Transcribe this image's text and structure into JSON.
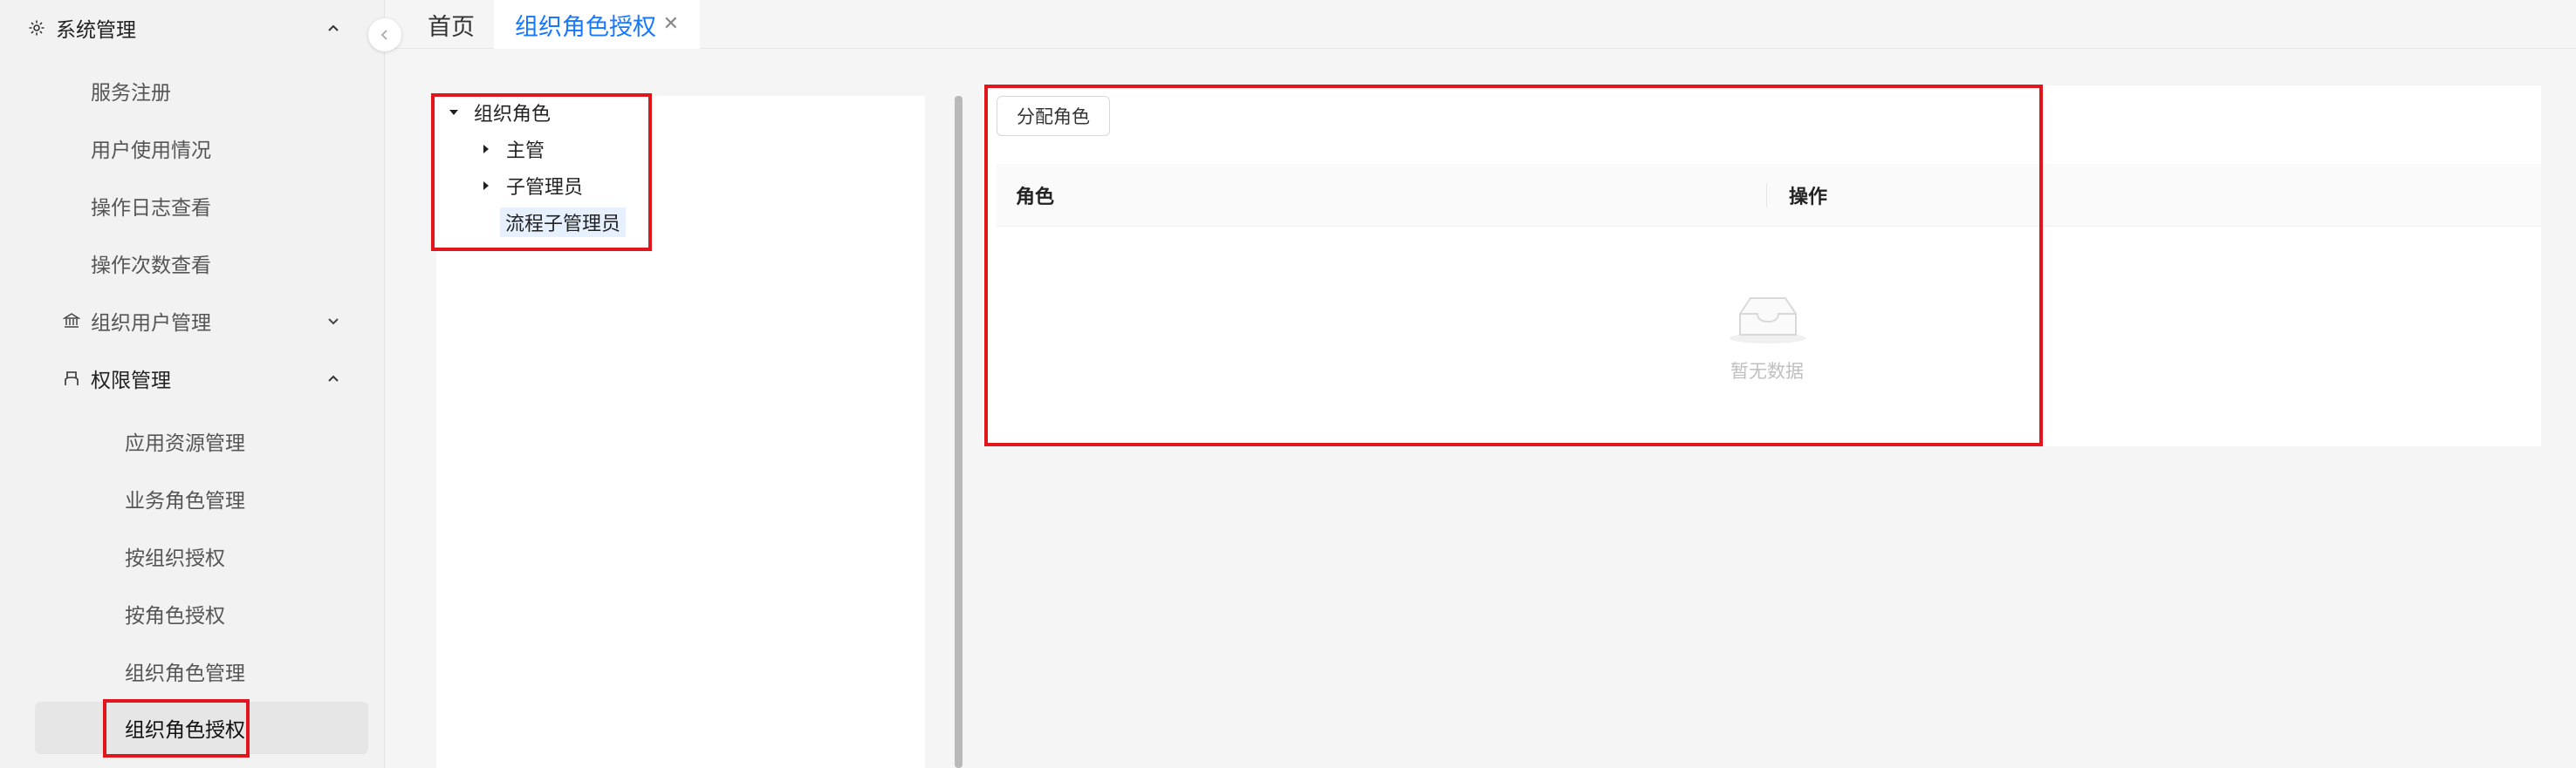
{
  "sidebar": {
    "system_menu": {
      "label": "系统管理"
    },
    "items": [
      {
        "label": "服务注册"
      },
      {
        "label": "用户使用情况"
      },
      {
        "label": "操作日志查看"
      },
      {
        "label": "操作次数查看"
      }
    ],
    "org_user_menu": {
      "label": "组织用户管理"
    },
    "perm_menu": {
      "label": "权限管理"
    },
    "perm_items": [
      {
        "label": "应用资源管理"
      },
      {
        "label": "业务角色管理"
      },
      {
        "label": "按组织授权"
      },
      {
        "label": "按角色授权"
      },
      {
        "label": "组织角色管理"
      },
      {
        "label": "组织角色授权"
      }
    ]
  },
  "tabs": {
    "home": "首页",
    "current": "组织角色授权",
    "close_glyph": "✕"
  },
  "tree": {
    "root": "组织角色",
    "children": [
      {
        "label": "主管"
      },
      {
        "label": "子管理员"
      },
      {
        "label": "流程子管理员"
      }
    ]
  },
  "main": {
    "assign_button": "分配角色",
    "columns": {
      "role": "角色",
      "action": "操作"
    },
    "empty_text": "暂无数据"
  },
  "colors": {
    "accent": "#1677ff",
    "highlight_box": "#e0161c"
  }
}
